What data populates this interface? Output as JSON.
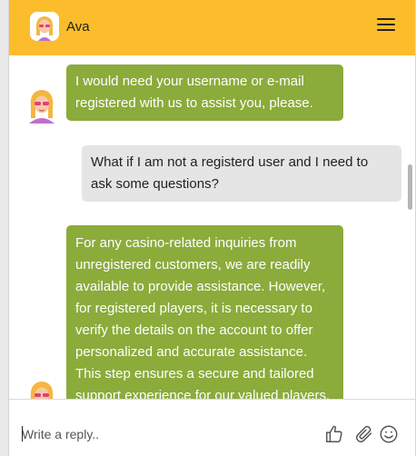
{
  "header": {
    "agent_name": "Ava",
    "avatar_icon": "agent-avatar-icon",
    "menu_icon": "hamburger-menu-icon",
    "bg_color": "#fbbd2b"
  },
  "messages": [
    {
      "sender": "bot",
      "text": "I would need your username or e-mail registered with us to assist you, please."
    },
    {
      "sender": "user",
      "text": "What if I am not a registerd user and I need to ask some questions?"
    },
    {
      "sender": "bot",
      "text": "For any casino-related inquiries from unregistered customers, we are readily available to provide assistance. However, for registered players, it is necessary to verify the details on the account to offer personalized and accurate assistance. This step ensures a secure and tailored support experience for our valued players."
    }
  ],
  "composer": {
    "placeholder": "Write a reply..",
    "icons": [
      "thumbs-up-icon",
      "paperclip-icon",
      "emoji-icon"
    ]
  },
  "colors": {
    "bot_bubble": "#8bab3b",
    "user_bubble": "#e5e5e5"
  }
}
